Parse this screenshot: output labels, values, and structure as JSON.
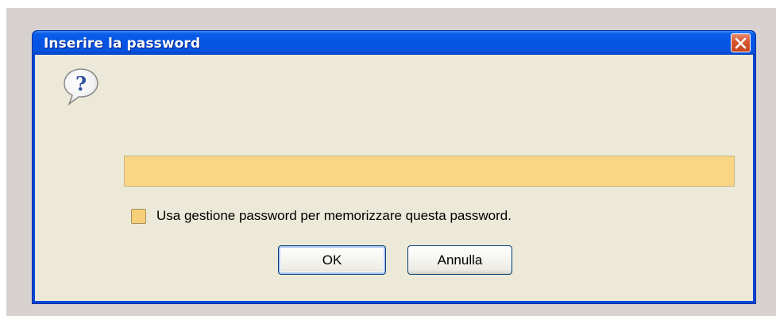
{
  "dialog": {
    "title": "Inserire la password",
    "close_icon": "close-icon",
    "prompt_icon": "question-icon",
    "password": {
      "value": "",
      "placeholder": ""
    },
    "remember_checkbox": {
      "checked": false,
      "label": "Usa gestione password per memorizzare questa password."
    },
    "buttons": {
      "ok_label": "OK",
      "cancel_label": "Annulla"
    }
  },
  "colors": {
    "titlebar": "#0454e5",
    "client_background": "#ece9d8",
    "input_highlight": "#f9d686",
    "close_button": "#d9582f"
  }
}
